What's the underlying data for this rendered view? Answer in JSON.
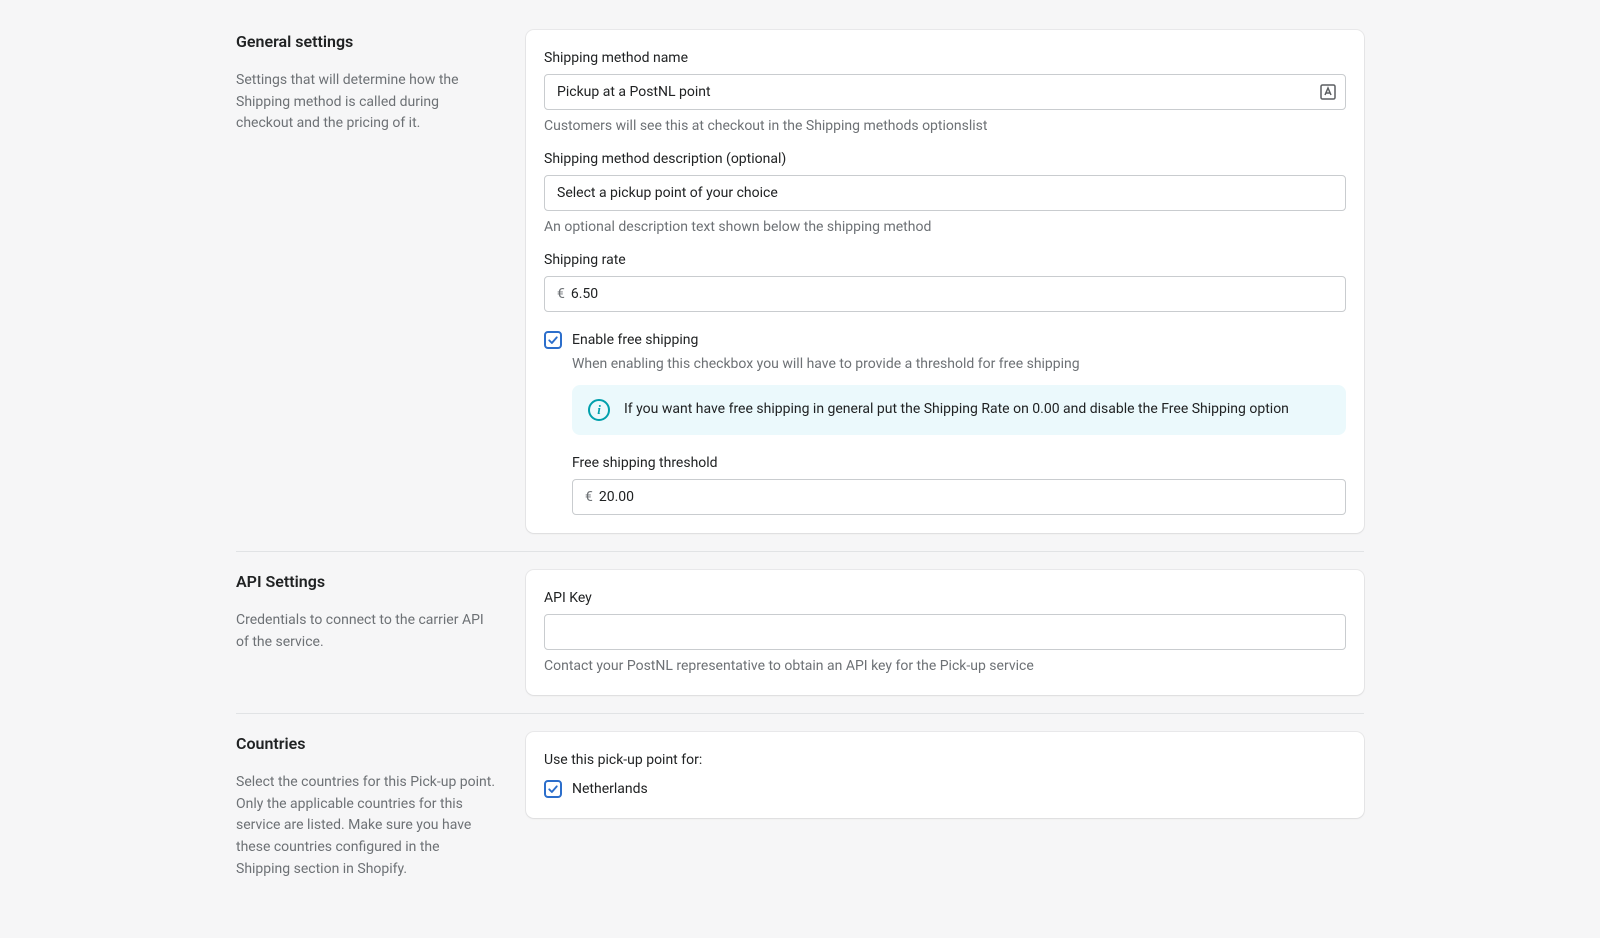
{
  "general": {
    "title": "General settings",
    "description": "Settings that will determine how the Shipping method is called during checkout and the pricing of it.",
    "method_name_label": "Shipping method name",
    "method_name_value": "Pickup at a PostNL point",
    "method_name_help": "Customers will see this at checkout in the Shipping methods optionslist",
    "method_desc_label": "Shipping method description (optional)",
    "method_desc_value": "Select a pickup point of your choice",
    "method_desc_help": "An optional description text shown below the shipping method",
    "rate_label": "Shipping rate",
    "rate_prefix": "€",
    "rate_value": "6.50",
    "free_shipping_label": "Enable free shipping",
    "free_shipping_checked": true,
    "free_shipping_help": "When enabling this checkbox you will have to provide a threshold for free shipping",
    "info_banner": "If you want have free shipping in general put the Shipping Rate on 0.00 and disable the Free Shipping option",
    "threshold_label": "Free shipping threshold",
    "threshold_prefix": "€",
    "threshold_value": "20.00"
  },
  "api": {
    "title": "API Settings",
    "description": "Credentials to connect to the carrier API of the service.",
    "key_label": "API Key",
    "key_value": "",
    "key_help": "Contact your PostNL representative to obtain an API key for the Pick-up service"
  },
  "countries": {
    "title": "Countries",
    "description": "Select the countries for this Pick-up point. Only the applicable countries for this service are listed. Make sure you have these countries configured in the Shipping section in Shopify.",
    "use_label": "Use this pick-up point for:",
    "items": [
      {
        "label": "Netherlands",
        "checked": true
      }
    ]
  }
}
